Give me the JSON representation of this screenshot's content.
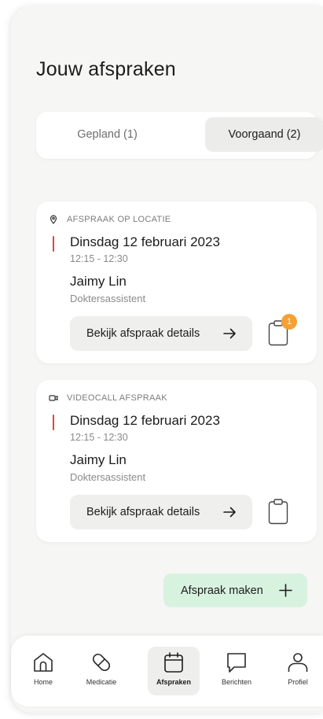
{
  "page_title": "Jouw afspraken",
  "segments": {
    "planned": "Gepland (1)",
    "past": "Voorgaand (2)",
    "selected": "Voorgaand (2)"
  },
  "appointments": [
    {
      "type": "AFSPRAAK OP LOCATIE",
      "type_icon": "location-pin-icon",
      "date": "Dinsdag 12 februari 2023",
      "time": "12:15 - 12:30",
      "name": "Jaimy Lin",
      "role": "Doktersassistent",
      "details_label": "Bekijk afspraak details",
      "badge": "1"
    },
    {
      "type": "VIDEOCALL AFSPRAAK",
      "type_icon": "video-camera-icon",
      "date": "Dinsdag 12 februari 2023",
      "time": "12:15 - 12:30",
      "name": "Jaimy Lin",
      "role": "Doktersassistent",
      "details_label": "Bekijk afspraak details"
    }
  ],
  "make_appointment_label": "Afspraak maken",
  "nav": {
    "home": "Home",
    "medication": "Medicatie",
    "appointments": "Afspraken",
    "messages": "Berichten",
    "profile": "Profiel",
    "active": "Afspraken"
  },
  "colors": {
    "accent_red": "#e54141",
    "badge_orange": "#f4a135",
    "make_button_green": "#d8f2e0",
    "background": "#f6f6f5"
  }
}
